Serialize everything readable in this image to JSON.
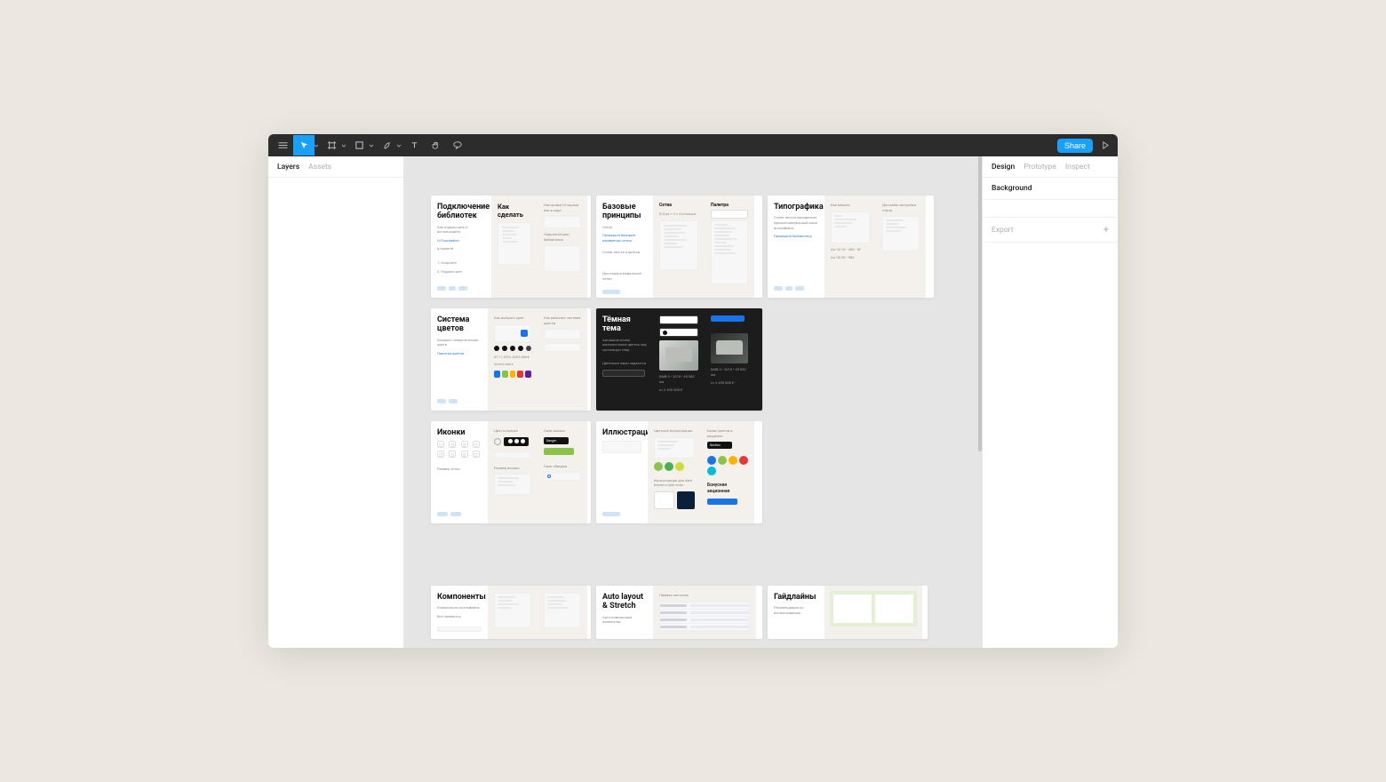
{
  "toolbar": {
    "share_label": "Share"
  },
  "left_panel": {
    "tabs": {
      "layers": "Layers",
      "assets": "Assets"
    }
  },
  "right_panel": {
    "tabs": {
      "design": "Design",
      "prototype": "Prototype",
      "inspect": "Inspect"
    },
    "background_label": "Background",
    "export_label": "Export"
  },
  "frames": {
    "row1": {
      "libs": {
        "title": "Подключение библиотек"
      },
      "basics": {
        "title": "Базовые принципы"
      },
      "typo": {
        "title": "Типографика"
      }
    },
    "row2": {
      "colors": {
        "title": "Система цветов"
      },
      "dark": {
        "title": "Тёмная тема"
      }
    },
    "row3": {
      "icons": {
        "title": "Иконки"
      },
      "illus": {
        "title": "Иллюстрации"
      }
    },
    "row4": {
      "components": {
        "title": "Компоненты"
      },
      "autolayout": {
        "title": "Auto layout & Stretch"
      },
      "guidelines": {
        "title": "Гайдлайны"
      }
    }
  }
}
